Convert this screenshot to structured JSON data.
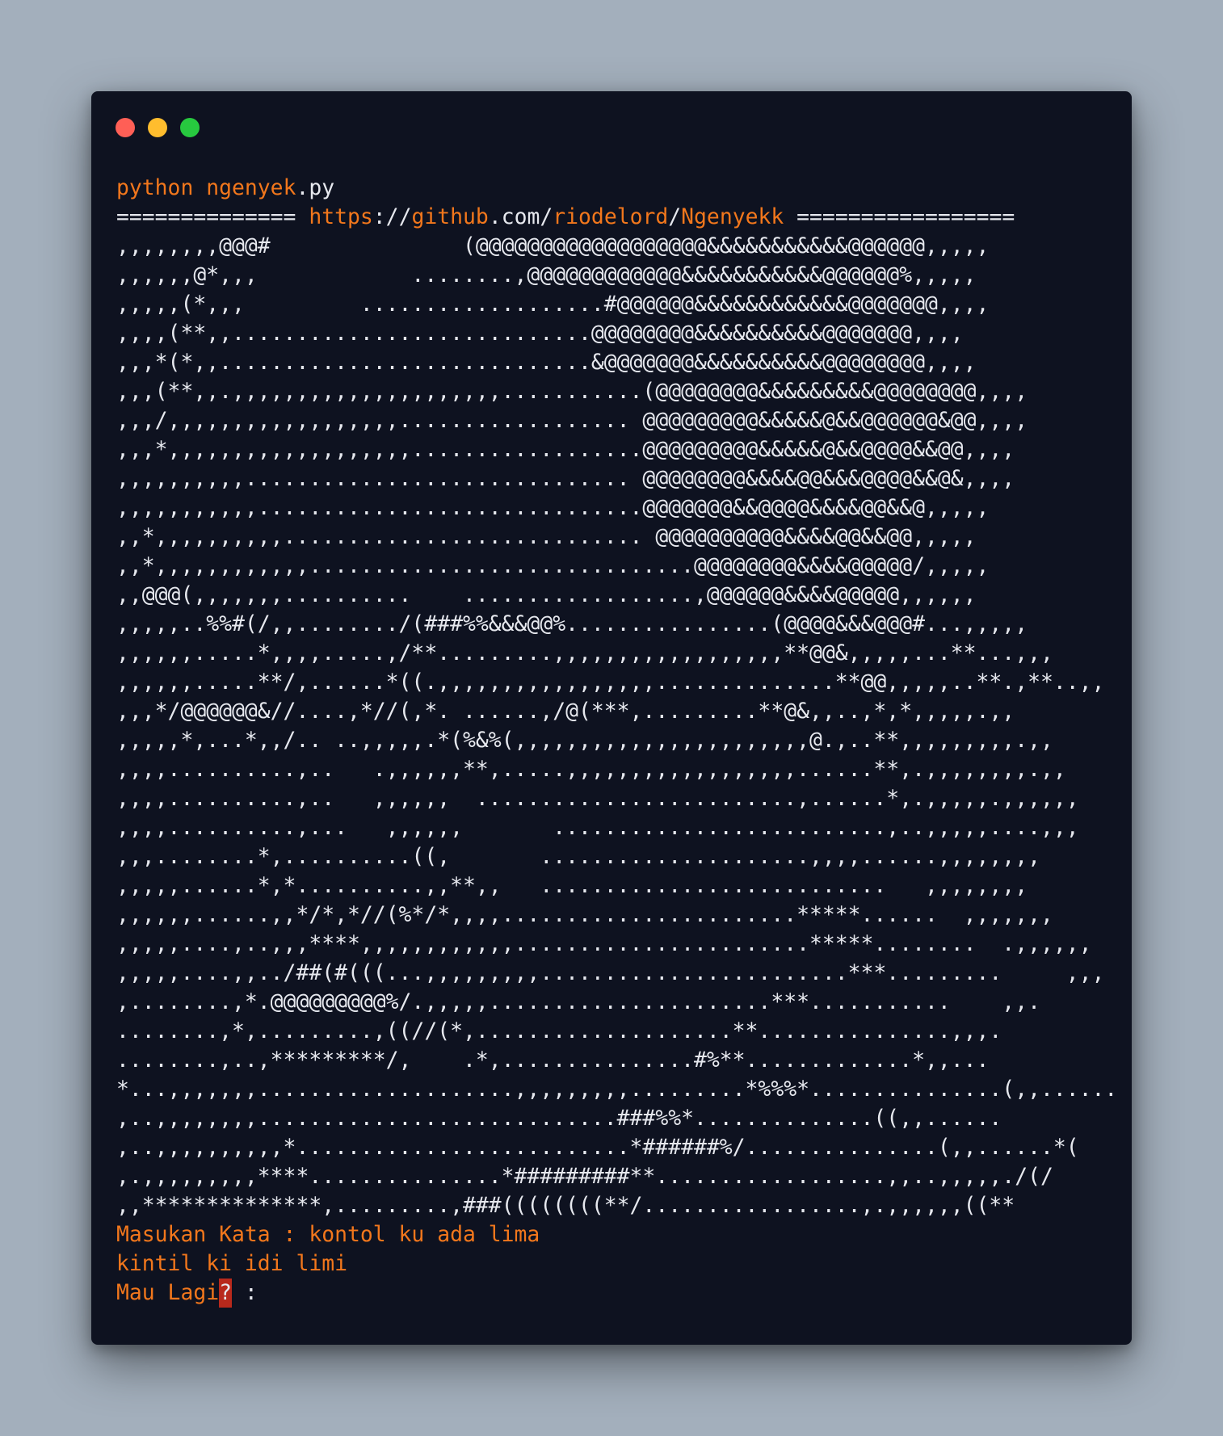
{
  "window": {
    "controls": [
      "close",
      "minimize",
      "maximize"
    ]
  },
  "terminal": {
    "command": {
      "prog": "python",
      "script": "ngenyek",
      "ext": ".py"
    },
    "banner": {
      "left_rule": "==============",
      "scheme": "https",
      "sep1": "://",
      "host": "github",
      "tld": ".com",
      "sep2": "/",
      "user": "riodelord",
      "sep3": "/",
      "repo": "Ngenyekk",
      "right_rule": "================="
    },
    "art_lines": [
      ",,,,,,,,@@@#               (@@@@@@@@@@@@@@@@@@&&&&&&&&&&&@@@@@@,,,,,",
      ",,,,,,@*,,,            ........,@@@@@@@@@@@@&&&&&&&&&&&@@@@@@%,,,,,",
      ",,,,,(*,,,         ...................#@@@@@@&&&&&&&&&&&&@@@@@@@,,,,",
      ",,,,(**,,............................@@@@@@@@&&&&&&&&&&@@@@@@@,,,,",
      ",,,*(*,,.............................&@@@@@@@&&&&&&&&&&@@@@@@@@,,,,",
      ",,,(**,,.,,,,,,,,,,,,,,,,,,,,,...........(@@@@@@@@&&&&&&&&&@@@@@@@@,,,,",
      ",,,/,,,,,,,,,,,,,,,,,,.................. @@@@@@@@@&&&&&@&&@@@@@@&@@,,,,",
      ",,,*,,,,,,,,,,,,,,,,,,,..................@@@@@@@@@&&&&&@&&@@@@&&@@,,,,",
      ",,,,,,,,,,.............................. @@@@@@@@&&&&@@&&&@@@@&&@&,,,,",
      ",,,,,,,,,,,..............................@@@@@@@&&@@@@&&&&@@&&@,,,,,",
      ",,*,,,,,,,,,,............................ @@@@@@@@@@&&&&@@&&@@,,,,,",
      ",,*,,,,,,,,,,,,..............................@@@@@@@@&&&&@@@@@/,,,,,",
      ",,@@@(,,,,,,,..........    ..................,@@@@@@&&&&@@@@@,,,,,,",
      ",,,,,..%%#(/,,......../(###%%&&&@@%................(@@@@&&&@@@#...,,,,,",
      ",,,,,,.....*,,,,.....,/**.........,,,,,,,,,,,,,,,,,,**@@&,,,,,...**...,,,",
      ",,,,,,.....**/,......*((.,,,,,,,,,,,,,,,,,..............**@@,,,,,..**.,**..,,",
      ",,,*/@@@@@@&//....,*//(,*. ......,/@(***,.........**@&,,..,*,*,,,,,.,,",
      ",,,,,*,...*,,/.. ..,,,,,.*(%&%(,,,,,,,,,,,,,,,,,,,,,,,@.,..**,,,,,,,,,.,,",
      ",,,,..........,..   .,,,,,,**,.....,,,,,,,,,,,,,,,,,,......**,.,,,,,,,,.,,",
      ",,,,..........,..   ,,,,,,  .........................,......*,.,,,,,.,,,,,,",
      ",,,,..........,...   ,,,,,,       ..........................,..,,,,,....,,,",
      ",,,........*,..........((,       .....................,,,,......,,,,,,,,",
      ",,,,,......*,*..........,,**,,   ...........................   ,,,,,,,,",
      ",,,,,,......,,*/*,*//(%*/*,,,,.......................*****......  ,,,,,,,",
      ",,,,,....,..,,,****,,,,,,,,,,,,.......................*****........  .,,,,,,",
      ",,,,,....,,../##(#(((...,,,,,,,,,........................***.........     ,,,",
      ",........,*.@@@@@@@@@%/.,,,,,......................***...........    ,,.",
      "........,*,.........,((//(*,....................**...............,,,.",
      "........,..,*********/,    .*,...............#%**.............*,,...",
      "*...,,,,,,,....................,,,,,,,,,.........*%%%*...............(,,......",
      ",..,,,,,,,,............................###%%*..............((,,......",
      ",..,,,,,,,,,,*..........................*######%/...............(,,......*(",
      ",.,,,,,,,,,****...............*#########**..................,,..,,,,,./(/",
      ",,**************,.........,###((((((((**/.................,.,,,,,,((**"
    ],
    "prompt_label": "Masukan Kata : ",
    "prompt_value": "kontol ku ada lima",
    "output": "kintil ki idi limi",
    "again_label": "Mau Lagi",
    "again_cursor": "?",
    "again_suffix": " :"
  }
}
